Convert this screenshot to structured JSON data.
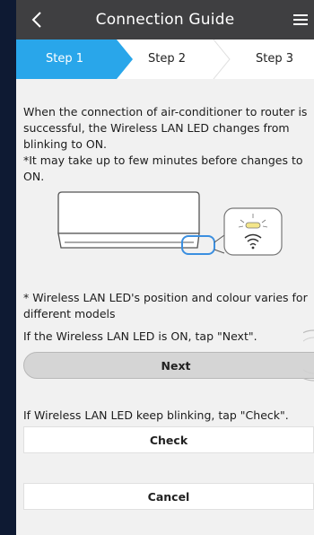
{
  "header": {
    "title": "Connection Guide",
    "back_icon": "chevron-left-icon",
    "menu_icon": "hamburger-menu-icon"
  },
  "steps": [
    {
      "label": "Step 1",
      "active": true
    },
    {
      "label": "Step 2",
      "active": false
    },
    {
      "label": "Step 3",
      "active": false
    }
  ],
  "description": {
    "line1": "When the connection of air-conditioner to router is successful, the Wireless LAN LED changes from blinking to ON.",
    "line2": "*It may take up to few minutes before changes to ON."
  },
  "illustration": {
    "icons": [
      "air-conditioner-icon",
      "led-indicator-icon",
      "wifi-icon"
    ]
  },
  "note": "* Wireless LAN LED's position and colour varies for different models",
  "next_section": {
    "instruction": "If the Wireless LAN LED is ON, tap \"Next\".",
    "button_label": "Next"
  },
  "check_section": {
    "instruction": "If Wireless LAN LED keep blinking, tap \"Check\".",
    "button_label": "Check"
  },
  "cancel_label": "Cancel",
  "colors": {
    "header_bg": "#3f3f41",
    "step_active": "#29a6ea",
    "led_highlight": "#3b8fe0",
    "led_yellow": "#f3e58a",
    "background": "#f1f1f1",
    "outer_border": "#0e1a33"
  }
}
